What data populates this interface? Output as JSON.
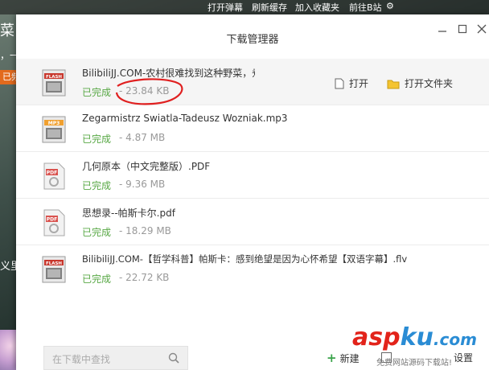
{
  "background": {
    "topbar_links": [
      "打开弹幕",
      "刷新缓存",
      "加入收藏夹",
      "前往B站"
    ],
    "side_text": [
      "菜",
      "，一",
      "已频",
      "义里"
    ]
  },
  "dialog": {
    "title": "下载管理器",
    "window_controls": [
      "minimize-icon",
      "maximize-icon",
      "close-icon"
    ]
  },
  "downloads": [
    {
      "name": "BilibiliJJ.COM-农村很难找到这种野菜，煮汤非常清甜...",
      "status": "已完成",
      "size": "23.84 KB",
      "icon": "flash-file-icon",
      "highlighted": true
    },
    {
      "name": "Zegarmistrz Swiatla-Tadeusz Wozniak.mp3",
      "status": "已完成",
      "size": "- 4.87 MB",
      "icon": "mp3-file-icon",
      "highlighted": false
    },
    {
      "name": "几何原本（中文完整版）.PDF",
      "status": "已完成",
      "size": "- 9.36 MB",
      "icon": "pdf-file-icon",
      "highlighted": false
    },
    {
      "name": "思想录--帕斯卡尔.pdf",
      "status": "已完成",
      "size": "- 18.29 MB",
      "icon": "pdf-file-icon",
      "highlighted": false
    },
    {
      "name": "BilibiliJJ.COM-【哲学科普】帕斯卡：感到绝望是因为心怀希望【双语字幕】.flv",
      "status": "已完成",
      "size": "- 22.72 KB",
      "icon": "flash-file-icon",
      "highlighted": false
    }
  ],
  "row_actions": {
    "open": "打开",
    "open_folder": "打开文件夹"
  },
  "footer": {
    "search_placeholder": "在下载中查找",
    "new_label": "新建",
    "settings_label": "设置"
  },
  "watermark": {
    "text_a": "asp",
    "text_b": "ku",
    "text_c": ".com",
    "sub": "免费网站源码下载站!"
  },
  "colors": {
    "status_done": "#58a845",
    "annotation": "#e02020",
    "folder": "#f4c430"
  }
}
